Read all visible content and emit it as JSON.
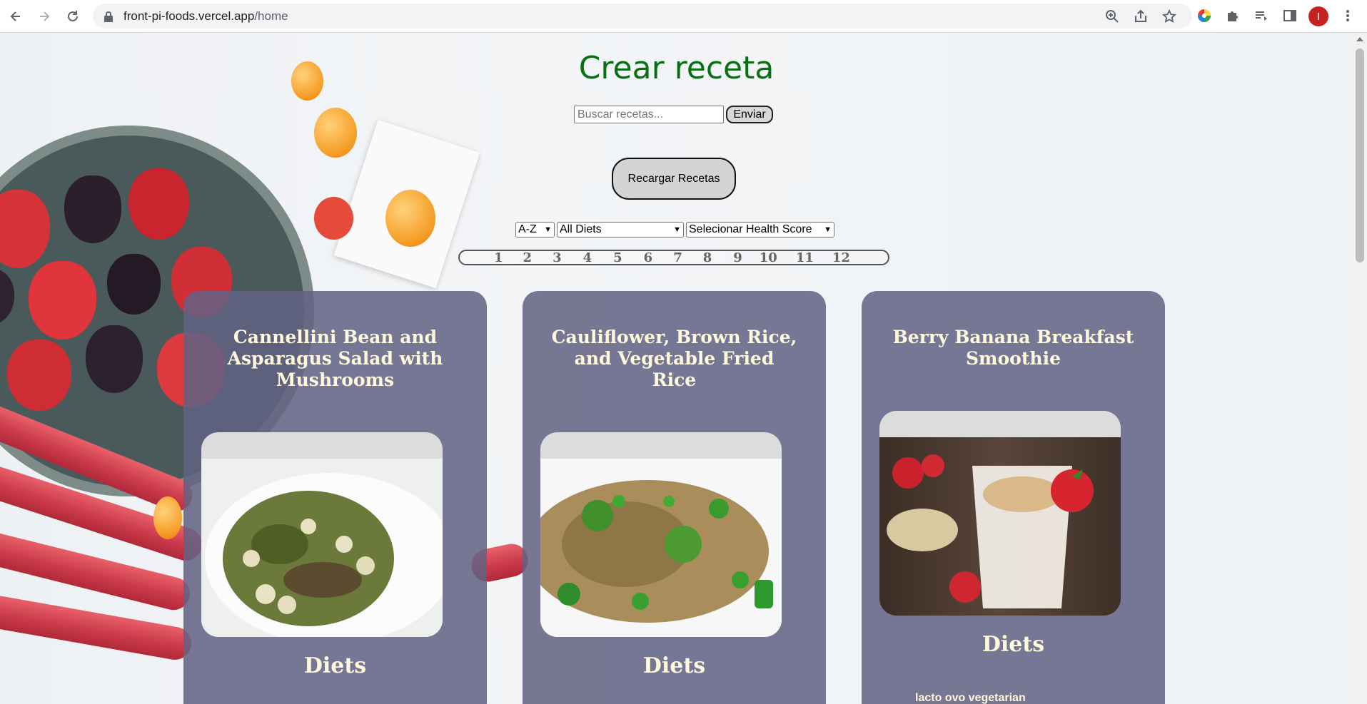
{
  "browser": {
    "url_host": "front-pi-foods.vercel.app",
    "url_path": "/home",
    "avatar_letter": "I",
    "icons": [
      "back-icon",
      "forward-icon",
      "reload-icon",
      "lock-icon",
      "zoom-icon",
      "share-icon",
      "star-icon",
      "color-wheel-icon",
      "puzzle-icon",
      "media-icon",
      "sidebar-icon",
      "kebab-icon"
    ]
  },
  "header": {
    "title": "Crear receta",
    "search_placeholder": "Buscar recetas...",
    "send_label": "Enviar",
    "reload_label": "Recargar Recetas"
  },
  "filters": {
    "order": "A-Z",
    "diet": "All Diets",
    "health": "Selecionar Health Score"
  },
  "pagination": {
    "pages": [
      "1",
      "2",
      "3",
      "4",
      "5",
      "6",
      "7",
      "8",
      "9",
      "10",
      "11",
      "12"
    ]
  },
  "cards": [
    {
      "name": "Cannellini Bean and Asparagus Salad with Mushrooms",
      "diets_title": "Diets",
      "diets": []
    },
    {
      "name": "Cauliflower, Brown Rice, and Vegetable Fried Rice",
      "diets_title": "Diets",
      "diets": []
    },
    {
      "name": "Berry Banana Breakfast Smoothie",
      "diets_title": "Diets",
      "diets": [
        "lacto ovo vegetarian"
      ]
    }
  ],
  "colors": {
    "title": "#087010",
    "card_bg": "#626284",
    "card_text": "#fff8dc"
  }
}
